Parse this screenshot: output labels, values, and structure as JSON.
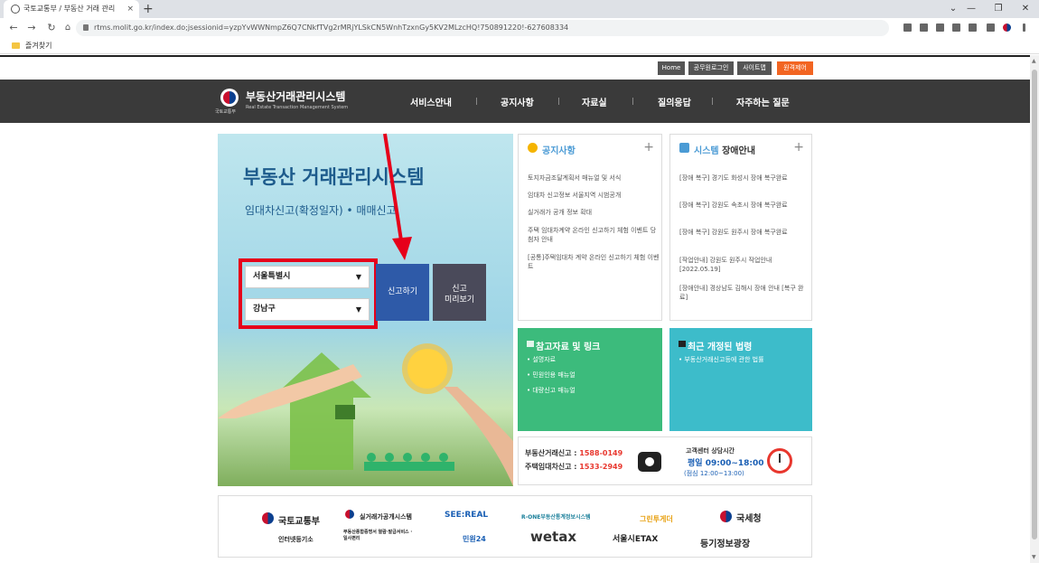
{
  "browser": {
    "tab_title": "국토교통부 / 부동산 거래 관리",
    "tab_close": "×",
    "new_tab": "+",
    "url": "rtms.molit.go.kr/index.do;jsessionid=yzpYvWWNmpZ6Q7CNkfTVg2rMRjYLSkCN5WnhTzxnGy5KV2MLzcHQ!750891220!-627608334",
    "back": "←",
    "forward": "→",
    "reload": "↻",
    "bookmark_folder": "즐겨찾기",
    "win_min": "—",
    "win_max": "❐",
    "win_close": "✕",
    "chevron": "⌄"
  },
  "util_links": {
    "home": "Home",
    "official_login": "공무원로그인",
    "sitemap": "사이트맵",
    "remote": "원격제어"
  },
  "header": {
    "logo_title": "부동산거래관리시스템",
    "logo_sub": "Real Estate Transaction Management System",
    "ministry_mini": "국토교통부"
  },
  "menu": [
    "서비스안내",
    "공지사항",
    "자료실",
    "질의응답",
    "자주하는 질문"
  ],
  "hero": {
    "title": "부동산 거래관리시스템",
    "subtitle": "임대차신고(확정일자) • 매매신고",
    "city": "서울특별시",
    "district": "강남구",
    "report_btn": "신고하기",
    "preview_btn_line1": "신고",
    "preview_btn_line2": "미리보기"
  },
  "notice": {
    "title": "공지사항",
    "plus": "+",
    "items": [
      "토지자금조달계획서 매뉴얼 및 서식",
      "임대차 신고정보 서울지역 시범공개",
      "실거래가 공개 정보 확대",
      "주택 임대차계약 온라인 신고하기 체험 이벤트 당첨자 안내",
      "[공통]주택임대차 계약 온라인 신고하기 체험 이벤트"
    ]
  },
  "outage": {
    "title_a": "시스템",
    "title_b": "장애안내",
    "plus": "+",
    "items": [
      "[장애 복구] 경기도 화성시 장애 복구완료",
      "[장애 복구] 강원도 속초시 장애 복구완료",
      "[장애 복구] 강원도 원주시 장애 복구완료",
      "[작업안내] 강원도 원주시 작업안내 [2022.05.19]",
      "[장애안내] 경상남도 김해시 장애 안내 [복구 완료]"
    ]
  },
  "reference": {
    "title": "참고자료 및 링크",
    "items": [
      "설명자료",
      "민원인용 매뉴얼",
      "대량신고 매뉴얼"
    ]
  },
  "laws": {
    "title": "최근 개정된 법령",
    "items": [
      "부동산거래신고등에 관한 법률"
    ]
  },
  "contact": {
    "line1_label": "부동산거래신고 : ",
    "line1_num": "1588-0149",
    "line2_label": "주택임대차신고 : ",
    "line2_num": "1533-2949",
    "center_title": "고객센터 상담시간",
    "weekday": "평일 09:00~18:00",
    "lunch": "(점심 12:00~13:00)"
  },
  "partners": [
    "국토교통부",
    "실거래가공개시스템",
    "SEE:REAL",
    "R-ONE부동산통계정보시스템",
    "그린투게더",
    "국세청",
    "인터넷등기소",
    "부동산종합증명서 열람·발급서비스 · 일사편리",
    "민원24",
    "wetax",
    "서울시ETAX",
    "등기정보광장"
  ],
  "colors": {
    "gnb": "#3a3a3a",
    "accent_blue": "#2e5aa8",
    "green_box": "#3cbb7c",
    "teal_box": "#3dbcca",
    "remote_btn": "#f26522",
    "red_highlight": "#e6001a"
  }
}
